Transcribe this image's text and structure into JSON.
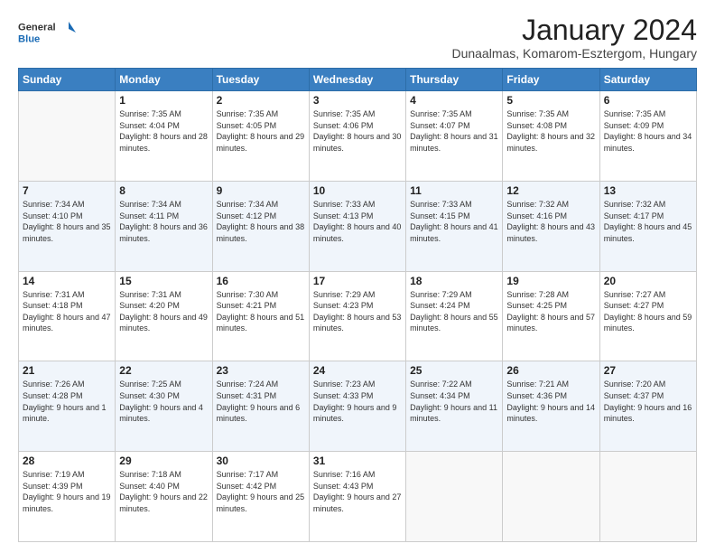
{
  "logo": {
    "text_general": "General",
    "text_blue": "Blue"
  },
  "header": {
    "month_year": "January 2024",
    "location": "Dunaalmas, Komarom-Esztergom, Hungary"
  },
  "days_of_week": [
    "Sunday",
    "Monday",
    "Tuesday",
    "Wednesday",
    "Thursday",
    "Friday",
    "Saturday"
  ],
  "weeks": [
    [
      {
        "day": "",
        "sunrise": "",
        "sunset": "",
        "daylight": ""
      },
      {
        "day": "1",
        "sunrise": "Sunrise: 7:35 AM",
        "sunset": "Sunset: 4:04 PM",
        "daylight": "Daylight: 8 hours and 28 minutes."
      },
      {
        "day": "2",
        "sunrise": "Sunrise: 7:35 AM",
        "sunset": "Sunset: 4:05 PM",
        "daylight": "Daylight: 8 hours and 29 minutes."
      },
      {
        "day": "3",
        "sunrise": "Sunrise: 7:35 AM",
        "sunset": "Sunset: 4:06 PM",
        "daylight": "Daylight: 8 hours and 30 minutes."
      },
      {
        "day": "4",
        "sunrise": "Sunrise: 7:35 AM",
        "sunset": "Sunset: 4:07 PM",
        "daylight": "Daylight: 8 hours and 31 minutes."
      },
      {
        "day": "5",
        "sunrise": "Sunrise: 7:35 AM",
        "sunset": "Sunset: 4:08 PM",
        "daylight": "Daylight: 8 hours and 32 minutes."
      },
      {
        "day": "6",
        "sunrise": "Sunrise: 7:35 AM",
        "sunset": "Sunset: 4:09 PM",
        "daylight": "Daylight: 8 hours and 34 minutes."
      }
    ],
    [
      {
        "day": "7",
        "sunrise": "Sunrise: 7:34 AM",
        "sunset": "Sunset: 4:10 PM",
        "daylight": "Daylight: 8 hours and 35 minutes."
      },
      {
        "day": "8",
        "sunrise": "Sunrise: 7:34 AM",
        "sunset": "Sunset: 4:11 PM",
        "daylight": "Daylight: 8 hours and 36 minutes."
      },
      {
        "day": "9",
        "sunrise": "Sunrise: 7:34 AM",
        "sunset": "Sunset: 4:12 PM",
        "daylight": "Daylight: 8 hours and 38 minutes."
      },
      {
        "day": "10",
        "sunrise": "Sunrise: 7:33 AM",
        "sunset": "Sunset: 4:13 PM",
        "daylight": "Daylight: 8 hours and 40 minutes."
      },
      {
        "day": "11",
        "sunrise": "Sunrise: 7:33 AM",
        "sunset": "Sunset: 4:15 PM",
        "daylight": "Daylight: 8 hours and 41 minutes."
      },
      {
        "day": "12",
        "sunrise": "Sunrise: 7:32 AM",
        "sunset": "Sunset: 4:16 PM",
        "daylight": "Daylight: 8 hours and 43 minutes."
      },
      {
        "day": "13",
        "sunrise": "Sunrise: 7:32 AM",
        "sunset": "Sunset: 4:17 PM",
        "daylight": "Daylight: 8 hours and 45 minutes."
      }
    ],
    [
      {
        "day": "14",
        "sunrise": "Sunrise: 7:31 AM",
        "sunset": "Sunset: 4:18 PM",
        "daylight": "Daylight: 8 hours and 47 minutes."
      },
      {
        "day": "15",
        "sunrise": "Sunrise: 7:31 AM",
        "sunset": "Sunset: 4:20 PM",
        "daylight": "Daylight: 8 hours and 49 minutes."
      },
      {
        "day": "16",
        "sunrise": "Sunrise: 7:30 AM",
        "sunset": "Sunset: 4:21 PM",
        "daylight": "Daylight: 8 hours and 51 minutes."
      },
      {
        "day": "17",
        "sunrise": "Sunrise: 7:29 AM",
        "sunset": "Sunset: 4:23 PM",
        "daylight": "Daylight: 8 hours and 53 minutes."
      },
      {
        "day": "18",
        "sunrise": "Sunrise: 7:29 AM",
        "sunset": "Sunset: 4:24 PM",
        "daylight": "Daylight: 8 hours and 55 minutes."
      },
      {
        "day": "19",
        "sunrise": "Sunrise: 7:28 AM",
        "sunset": "Sunset: 4:25 PM",
        "daylight": "Daylight: 8 hours and 57 minutes."
      },
      {
        "day": "20",
        "sunrise": "Sunrise: 7:27 AM",
        "sunset": "Sunset: 4:27 PM",
        "daylight": "Daylight: 8 hours and 59 minutes."
      }
    ],
    [
      {
        "day": "21",
        "sunrise": "Sunrise: 7:26 AM",
        "sunset": "Sunset: 4:28 PM",
        "daylight": "Daylight: 9 hours and 1 minute."
      },
      {
        "day": "22",
        "sunrise": "Sunrise: 7:25 AM",
        "sunset": "Sunset: 4:30 PM",
        "daylight": "Daylight: 9 hours and 4 minutes."
      },
      {
        "day": "23",
        "sunrise": "Sunrise: 7:24 AM",
        "sunset": "Sunset: 4:31 PM",
        "daylight": "Daylight: 9 hours and 6 minutes."
      },
      {
        "day": "24",
        "sunrise": "Sunrise: 7:23 AM",
        "sunset": "Sunset: 4:33 PM",
        "daylight": "Daylight: 9 hours and 9 minutes."
      },
      {
        "day": "25",
        "sunrise": "Sunrise: 7:22 AM",
        "sunset": "Sunset: 4:34 PM",
        "daylight": "Daylight: 9 hours and 11 minutes."
      },
      {
        "day": "26",
        "sunrise": "Sunrise: 7:21 AM",
        "sunset": "Sunset: 4:36 PM",
        "daylight": "Daylight: 9 hours and 14 minutes."
      },
      {
        "day": "27",
        "sunrise": "Sunrise: 7:20 AM",
        "sunset": "Sunset: 4:37 PM",
        "daylight": "Daylight: 9 hours and 16 minutes."
      }
    ],
    [
      {
        "day": "28",
        "sunrise": "Sunrise: 7:19 AM",
        "sunset": "Sunset: 4:39 PM",
        "daylight": "Daylight: 9 hours and 19 minutes."
      },
      {
        "day": "29",
        "sunrise": "Sunrise: 7:18 AM",
        "sunset": "Sunset: 4:40 PM",
        "daylight": "Daylight: 9 hours and 22 minutes."
      },
      {
        "day": "30",
        "sunrise": "Sunrise: 7:17 AM",
        "sunset": "Sunset: 4:42 PM",
        "daylight": "Daylight: 9 hours and 25 minutes."
      },
      {
        "day": "31",
        "sunrise": "Sunrise: 7:16 AM",
        "sunset": "Sunset: 4:43 PM",
        "daylight": "Daylight: 9 hours and 27 minutes."
      },
      {
        "day": "",
        "sunrise": "",
        "sunset": "",
        "daylight": ""
      },
      {
        "day": "",
        "sunrise": "",
        "sunset": "",
        "daylight": ""
      },
      {
        "day": "",
        "sunrise": "",
        "sunset": "",
        "daylight": ""
      }
    ]
  ]
}
